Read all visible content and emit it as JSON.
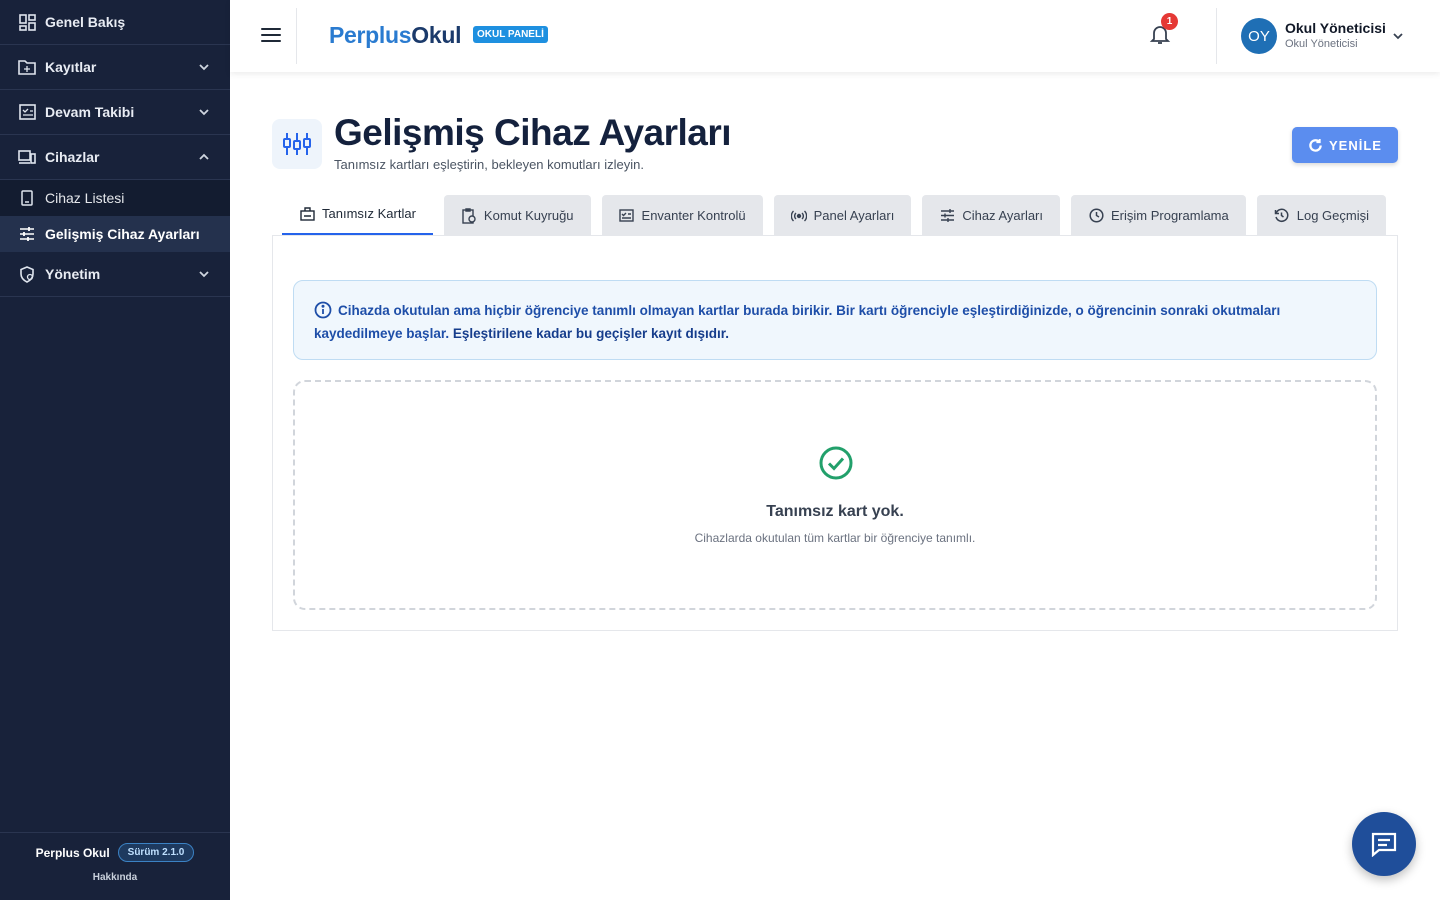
{
  "sidebar": {
    "items": [
      {
        "label": "Genel Bakış",
        "icon": "dashboard-icon"
      },
      {
        "label": "Kayıtlar",
        "icon": "folder-icon"
      },
      {
        "label": "Devam Takibi",
        "icon": "attendance-icon"
      },
      {
        "label": "Cihazlar",
        "icon": "devices-icon"
      },
      {
        "label": "Yönetim",
        "icon": "admin-icon"
      }
    ],
    "sub_items": [
      {
        "label": "Cihaz Listesi",
        "icon": "device-icon"
      },
      {
        "label": "Gelişmiş Cihaz Ayarları",
        "icon": "sliders-icon"
      }
    ],
    "footer": {
      "app_name": "Perplus Okul",
      "version": "Sürüm 2.1.0",
      "about": "Hakkında"
    }
  },
  "topbar": {
    "brand_part1": "Perplus",
    "brand_part2": "Okul",
    "panel_badge": "OKUL PANELİ",
    "notification_count": "1",
    "user": {
      "initials": "OY",
      "name": "Okul Yöneticisi",
      "role": "Okul Yöneticisi"
    }
  },
  "page": {
    "title": "Gelişmiş Cihaz Ayarları",
    "subtitle": "Tanımsız kartları eşleştirin, bekleyen komutları izleyin.",
    "refresh_label": "YENİLE"
  },
  "tabs": [
    {
      "label": "Tanımsız Kartlar",
      "icon": "card-icon",
      "active": true
    },
    {
      "label": "Komut Kuyruğu",
      "icon": "queue-icon",
      "active": false
    },
    {
      "label": "Envanter Kontrolü",
      "icon": "inventory-icon",
      "active": false
    },
    {
      "label": "Panel Ayarları",
      "icon": "broadcast-icon",
      "active": false
    },
    {
      "label": "Cihaz Ayarları",
      "icon": "tune-icon",
      "active": false
    },
    {
      "label": "Erişim Programlama",
      "icon": "clock-icon",
      "active": false
    },
    {
      "label": "Log Geçmişi",
      "icon": "history-icon",
      "active": false
    }
  ],
  "info": {
    "text": "Cihazda okutulan ama hiçbir öğrenciye tanımlı olmayan kartlar burada birikir. Bir kartı öğrenciyle eşleştirdiğinizde, o öğrencinin sonraki okutmaları kaydedilmeye başlar.",
    "emphasis": "Eşleştirilene kadar bu geçişler kayıt dışıdır."
  },
  "empty_state": {
    "title": "Tanımsız kart yok.",
    "description": "Cihazlarda okutulan tüm kartlar bir öğrenciye tanımlı."
  },
  "colors": {
    "sidebar_bg": "#18223a",
    "accent": "#2563eb",
    "success": "#22a06b",
    "chat": "#1f4e9a"
  }
}
